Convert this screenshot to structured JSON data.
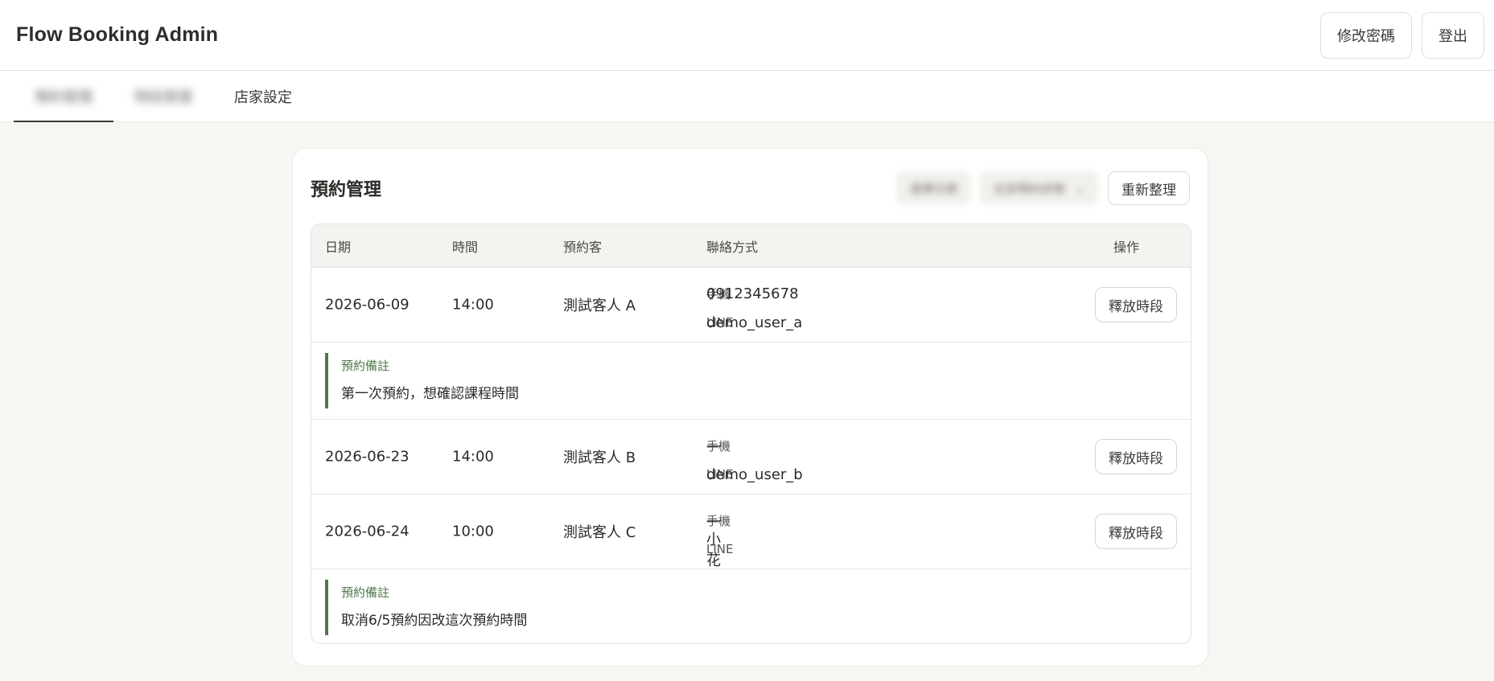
{
  "app": {
    "title": "Flow Booking Admin"
  },
  "top_actions": {
    "change_password": "修改密碼",
    "logout": "登出"
  },
  "tabs": [
    {
      "label": "預約管理"
    },
    {
      "label": "時段管理"
    },
    {
      "label": "店家設定"
    }
  ],
  "booking": {
    "title": "預約管理",
    "filters": {
      "date_label": "選擇日期",
      "status_label": "全部預約狀態"
    },
    "refresh_label": "重新整理",
    "columns": {
      "date": "日期",
      "time": "時間",
      "guest": "預約客",
      "contact": "聯絡方式",
      "action": "操作"
    },
    "contact_labels": {
      "phone": "手機",
      "line": "LINE"
    },
    "release_label": "釋放時段",
    "note_label": "預約備註",
    "rows": [
      {
        "date": "2026-06-09",
        "time": "14:00",
        "guest": "測試客人 A",
        "phone": "0912345678",
        "line": "demo_user_a",
        "note": "第一次預約，想確認課程時間"
      },
      {
        "date": "2026-06-23",
        "time": "14:00",
        "guest": "測試客人 B",
        "phone": "—",
        "line": "demo_user_b"
      },
      {
        "date": "2026-06-24",
        "time": "10:00",
        "guest": "測試客人 C",
        "phone": "—",
        "line": "小花",
        "note": "取消6/5預約因改這次預約時間"
      }
    ]
  }
}
